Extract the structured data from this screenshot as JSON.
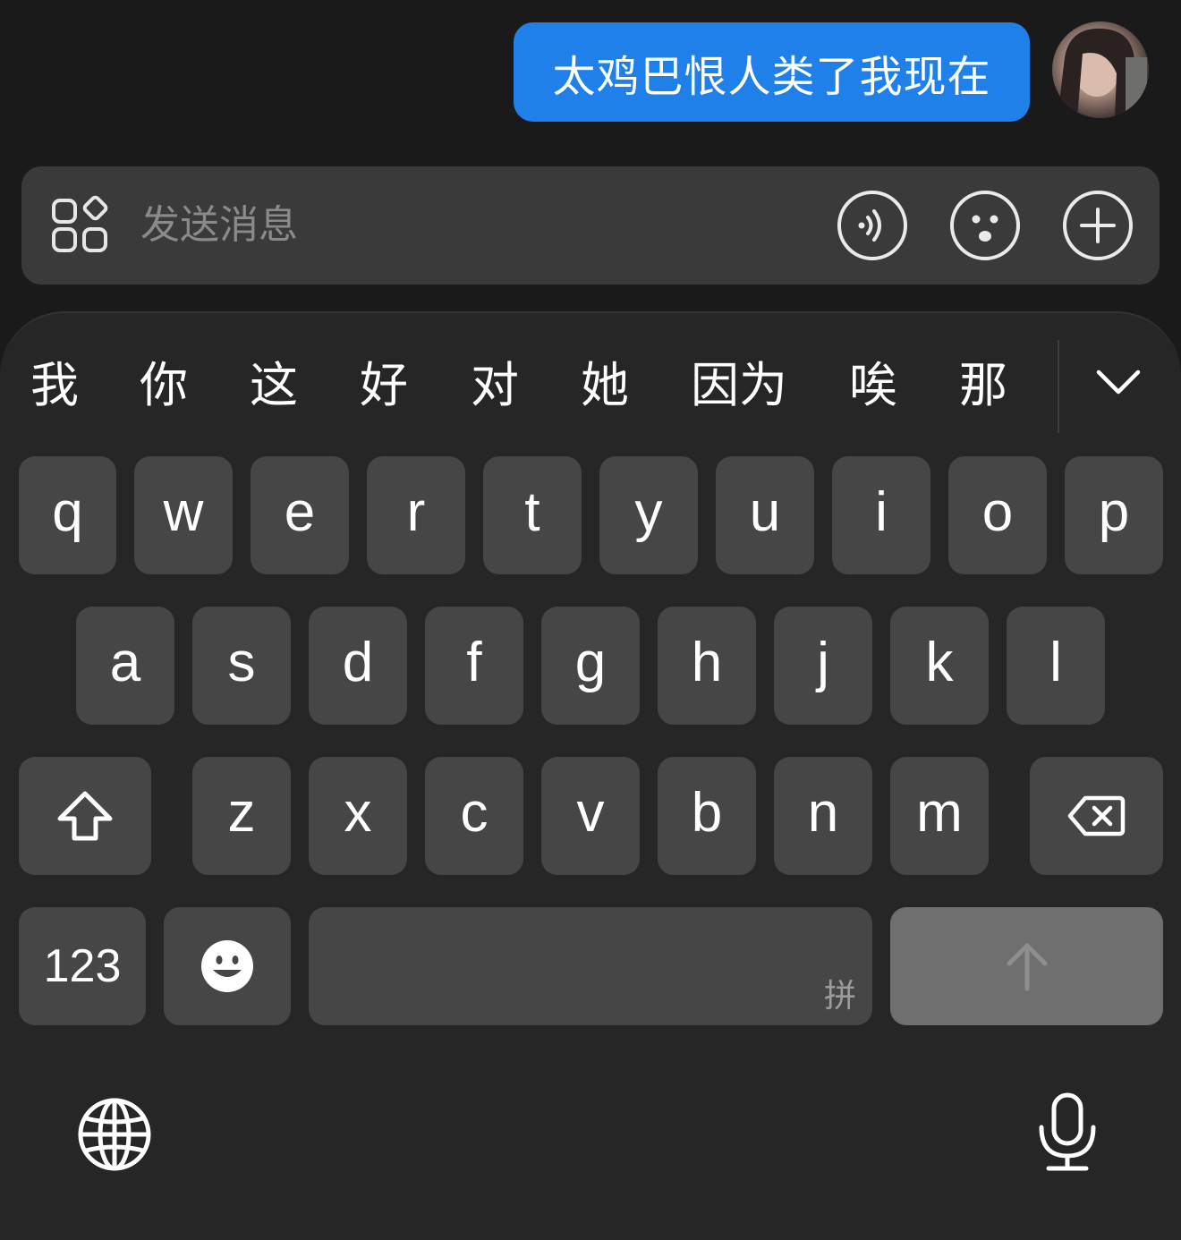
{
  "chat": {
    "message_text": "太鸡巴恨人类了我现在",
    "bubble_color": "#1f80ea"
  },
  "input_bar": {
    "placeholder": "发送消息",
    "left_icon": "apps-icon",
    "right_icons": [
      "voice-wave-icon",
      "emoji-face-icon",
      "plus-icon"
    ]
  },
  "keyboard": {
    "candidates": [
      "我",
      "你",
      "这",
      "好",
      "对",
      "她",
      "因为",
      "唉",
      "那"
    ],
    "expand_icon": "chevron-down-icon",
    "row1": [
      "q",
      "w",
      "e",
      "r",
      "t",
      "y",
      "u",
      "i",
      "o",
      "p"
    ],
    "row2": [
      "a",
      "s",
      "d",
      "f",
      "g",
      "h",
      "j",
      "k",
      "l"
    ],
    "row3": [
      "z",
      "x",
      "c",
      "v",
      "b",
      "n",
      "m"
    ],
    "shift_icon": "shift-arrow-icon",
    "delete_icon": "backspace-icon",
    "numbers_label": "123",
    "emoji_icon": "emoji-smile-icon",
    "space_hint": "拼",
    "return_icon": "arrow-up-icon",
    "globe_icon": "globe-icon",
    "mic_icon": "microphone-icon"
  }
}
